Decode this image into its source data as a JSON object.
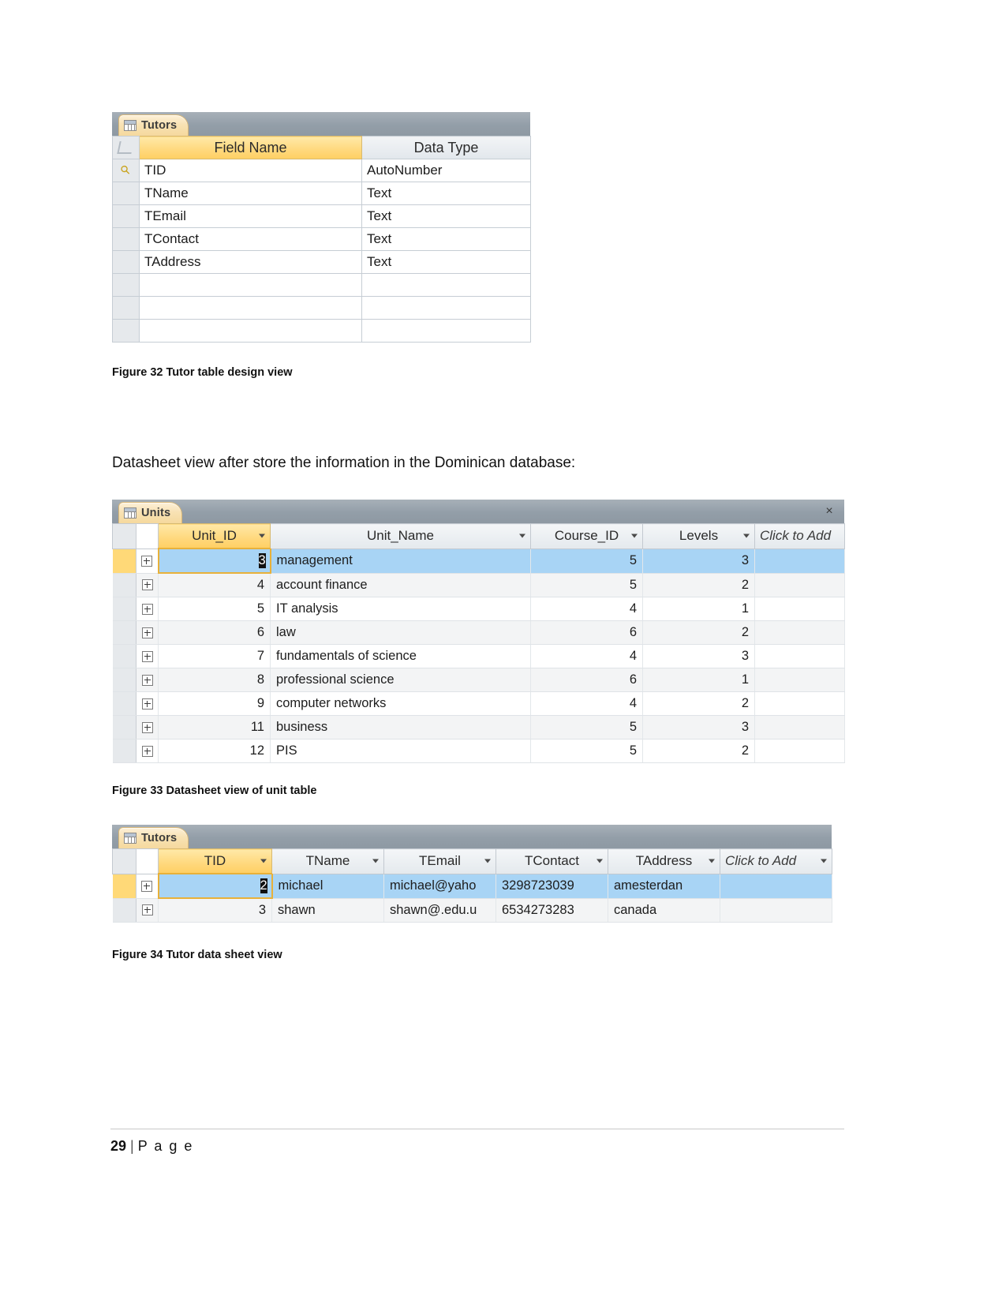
{
  "design_view": {
    "tab_label": "Tutors",
    "headers": {
      "field_name": "Field Name",
      "data_type": "Data Type"
    },
    "rows": [
      {
        "key": true,
        "field": "TID",
        "type": "AutoNumber"
      },
      {
        "key": false,
        "field": "TName",
        "type": "Text"
      },
      {
        "key": false,
        "field": "TEmail",
        "type": "Text"
      },
      {
        "key": false,
        "field": "TContact",
        "type": "Text"
      },
      {
        "key": false,
        "field": "TAddress",
        "type": "Text"
      }
    ],
    "empty_rows": 3,
    "caption": "Figure 32 Tutor table design view"
  },
  "intro_text": "Datasheet view after store the information in the Dominican database:",
  "units_datasheet": {
    "tab_label": "Units",
    "close_label": "×",
    "headers": [
      "Unit_ID",
      "Unit_Name",
      "Course_ID",
      "Levels",
      "Click to Add"
    ],
    "rows": [
      {
        "unit_id": "3",
        "unit_name": "management",
        "course_id": "5",
        "levels": "3",
        "selected": true
      },
      {
        "unit_id": "4",
        "unit_name": "account finance",
        "course_id": "5",
        "levels": "2",
        "selected": false
      },
      {
        "unit_id": "5",
        "unit_name": "IT analysis",
        "course_id": "4",
        "levels": "1",
        "selected": false
      },
      {
        "unit_id": "6",
        "unit_name": "law",
        "course_id": "6",
        "levels": "2",
        "selected": false
      },
      {
        "unit_id": "7",
        "unit_name": "fundamentals of science",
        "course_id": "4",
        "levels": "3",
        "selected": false
      },
      {
        "unit_id": "8",
        "unit_name": "professional science",
        "course_id": "6",
        "levels": "1",
        "selected": false
      },
      {
        "unit_id": "9",
        "unit_name": "computer networks",
        "course_id": "4",
        "levels": "2",
        "selected": false
      },
      {
        "unit_id": "11",
        "unit_name": "business",
        "course_id": "5",
        "levels": "3",
        "selected": false
      },
      {
        "unit_id": "12",
        "unit_name": "PIS",
        "course_id": "5",
        "levels": "2",
        "selected": false
      }
    ],
    "caption": "Figure 33 Datasheet view of unit table"
  },
  "tutors_datasheet": {
    "tab_label": "Tutors",
    "headers": [
      "TID",
      "TName",
      "TEmail",
      "TContact",
      "TAddress",
      "Click to Add"
    ],
    "rows": [
      {
        "tid": "2",
        "tname": "michael",
        "temail": "michael@yaho",
        "tcontact": "3298723039",
        "taddress": "amesterdan",
        "selected": true
      },
      {
        "tid": "3",
        "tname": "shawn",
        "temail": "shawn@.edu.u",
        "tcontact": "6534273283",
        "taddress": "canada",
        "selected": false
      }
    ],
    "caption": "Figure 34 Tutor data sheet view"
  },
  "footer": {
    "page_number": "29",
    "separator": "|",
    "page_word": "P a g e"
  },
  "colors": {
    "tab_bar": "#939ea8",
    "accent_yellow": "#ffd980",
    "selection_blue": "#a8d4f5"
  }
}
